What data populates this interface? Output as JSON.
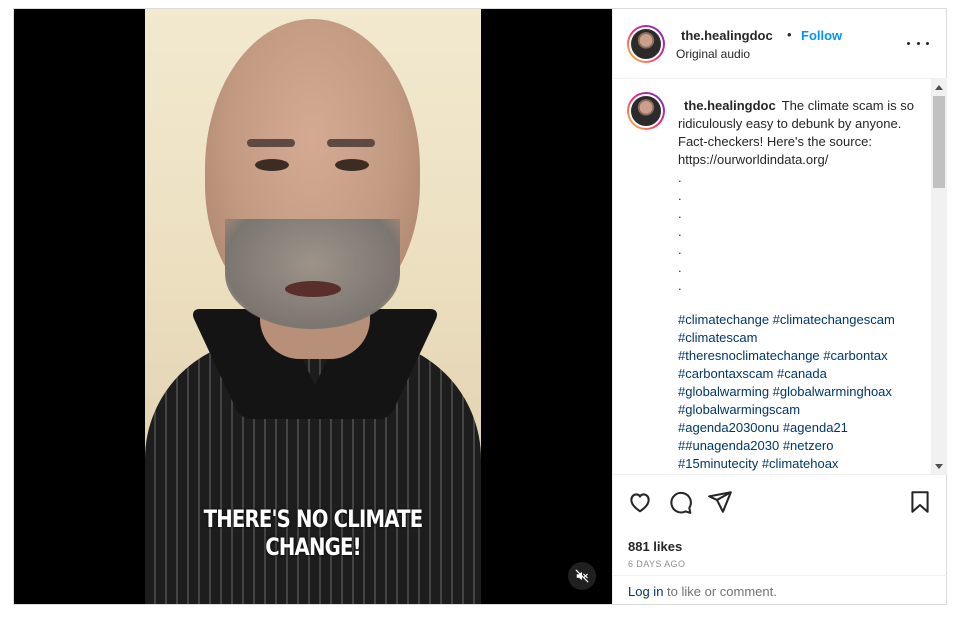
{
  "video": {
    "caption": "THERE'S NO CLIMATE CHANGE!",
    "mute_icon": "speaker-muted-icon"
  },
  "header": {
    "username": "the.healingdoc",
    "separator": "•",
    "follow_label": "Follow",
    "audio": "Original audio",
    "more_icon": "more-options-icon"
  },
  "post": {
    "username": "the.healingdoc",
    "caption": "The climate scam is so ridiculously easy to debunk by anyone.\nFact-checkers! Here's the source: https://ourworldindata.org/\n.\n.\n.\n.\n.\n.\n.",
    "hashtag_lines": [
      "#climatechange #climatechangescam",
      "#climatescam",
      "#theresnoclimatechange #carbontax",
      "#carbontaxscam #canada",
      "#globalwarming #globalwarminghoax",
      "#globalwarmingscam",
      "#agenda2030onu #agenda21",
      "##unagenda2030 #netzero",
      "#15minutecity #climatehoax"
    ]
  },
  "actions": {
    "likes": "881 likes",
    "time_ago": "6 DAYS AGO"
  },
  "footer": {
    "login_link": "Log in",
    "login_text": " to like or comment."
  },
  "colors": {
    "follow_blue": "#0095f6",
    "hashtag_blue": "#00376b",
    "muted_gray": "#8e8e8e"
  }
}
